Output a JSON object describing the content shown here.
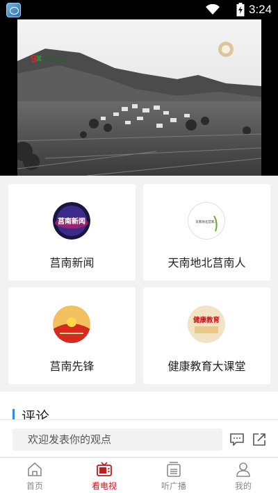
{
  "status_bar": {
    "time": "3:24"
  },
  "video": {
    "channel_logo_text": "莒南综合",
    "channel_logo_number": "9"
  },
  "programs": [
    {
      "label": "莒南新闻",
      "icon_text": "莒南新闻",
      "icon": "news-logo-icon"
    },
    {
      "label": "天南地北莒南人",
      "icon_text": "天南地北莒南人",
      "icon": "calligraphy-logo-icon"
    },
    {
      "label": "莒南先锋",
      "icon_text": "",
      "icon": "pioneer-logo-icon"
    },
    {
      "label": "健康教育大课堂",
      "icon_text": "健康教育",
      "icon": "health-logo-icon"
    }
  ],
  "comments": {
    "title": "评论",
    "placeholder": "欢迎发表你的观点"
  },
  "bottom_nav": [
    {
      "label": "首页",
      "icon": "home-icon",
      "active": false
    },
    {
      "label": "看电视",
      "icon": "tv-icon",
      "active": true
    },
    {
      "label": "听广播",
      "icon": "radio-icon",
      "active": false
    },
    {
      "label": "我的",
      "icon": "profile-icon",
      "active": false
    }
  ],
  "colors": {
    "accent": "#c8161d",
    "section_marker": "#2b8fdc",
    "inactive": "#8a8a8a"
  }
}
